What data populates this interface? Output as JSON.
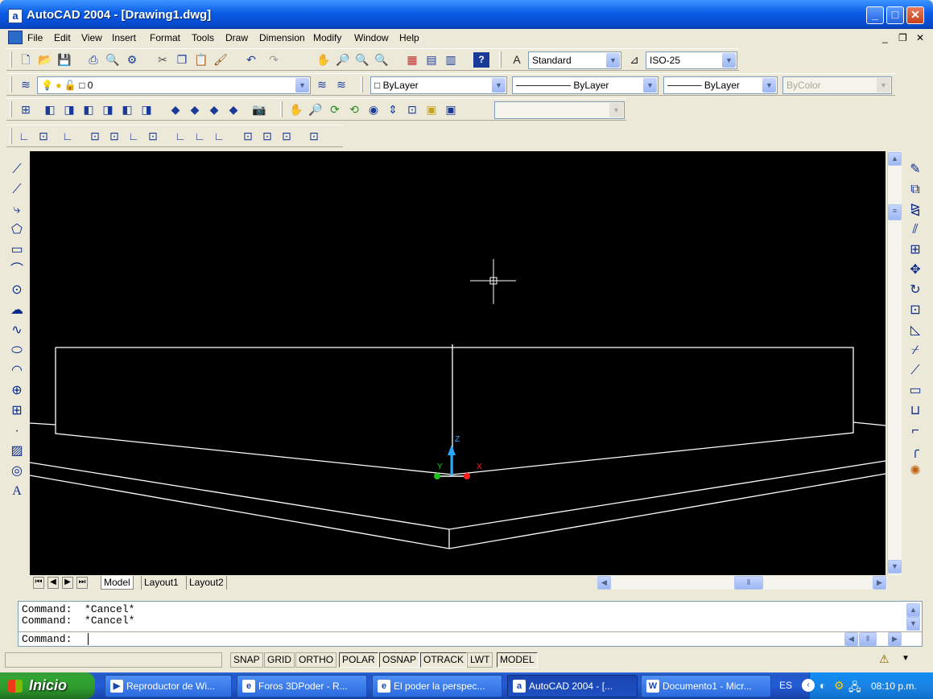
{
  "window": {
    "app_icon": "a",
    "title": "AutoCAD 2004 - [Drawing1.dwg]",
    "controls": {
      "minimize": "_",
      "maximize": "□",
      "close": "✕"
    }
  },
  "menu": {
    "items": [
      "File",
      "Edit",
      "View",
      "Insert",
      "Format",
      "Tools",
      "Draw",
      "Dimension",
      "Modify",
      "Window",
      "Help"
    ],
    "doc_controls": {
      "minimize": "_",
      "restore": "❐",
      "close": "✕"
    }
  },
  "toolbars": {
    "text_style": "Standard",
    "dim_style": "ISO-25",
    "layer": "0",
    "color": "ByLayer",
    "linetype": "ByLayer",
    "lineweight": "ByLayer",
    "plotstyle": "ByColor"
  },
  "ucs_labels": {
    "z": "Z",
    "y": "Y",
    "x": "X"
  },
  "tabs": [
    "Model",
    "Layout1",
    "Layout2"
  ],
  "command": {
    "history": [
      "Command:  *Cancel*",
      "Command:  *Cancel*"
    ],
    "prompt": "Command:"
  },
  "status": {
    "buttons": [
      {
        "label": "SNAP",
        "on": false
      },
      {
        "label": "GRID",
        "on": false
      },
      {
        "label": "ORTHO",
        "on": false
      },
      {
        "label": "POLAR",
        "on": true
      },
      {
        "label": "OSNAP",
        "on": true
      },
      {
        "label": "OTRACK",
        "on": true
      },
      {
        "label": "LWT",
        "on": false
      },
      {
        "label": "MODEL",
        "on": true
      }
    ]
  },
  "taskbar": {
    "start": "Inicio",
    "tasks": [
      {
        "label": "Reproductor de Wi...",
        "active": false
      },
      {
        "label": "Foros 3DPoder - R...",
        "active": false
      },
      {
        "label": "El poder la perspec...",
        "active": false
      },
      {
        "label": "AutoCAD 2004 - [...",
        "active": true
      },
      {
        "label": "Documento1 - Micr...",
        "active": false
      }
    ],
    "language": "ES",
    "clock": "08:10 p.m."
  },
  "colors": {
    "canvas": "#000000",
    "lines": "#ffffff",
    "ucs_z": "#2aa8ff",
    "ucs_x": "#ff2020",
    "ucs_y": "#20c020"
  }
}
